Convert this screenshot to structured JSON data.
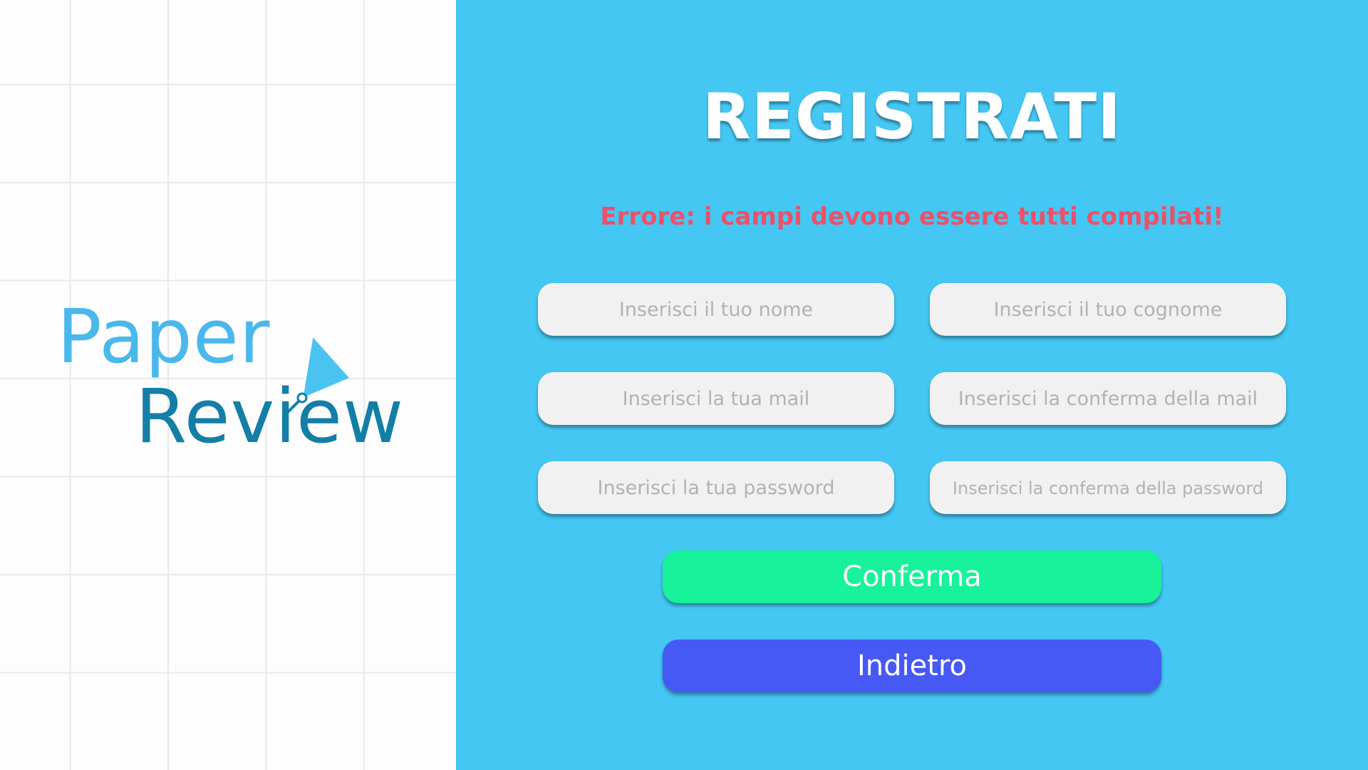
{
  "brand": {
    "line1": "Paper",
    "line2": "Review",
    "colors": {
      "paper": "#4ab8ea",
      "review": "#137ea6"
    }
  },
  "form": {
    "title": "REGISTRATI",
    "error": "Errore: i campi devono essere tutti compilati!",
    "fields": {
      "nome": {
        "placeholder": "Inserisci il tuo nome",
        "value": ""
      },
      "cognome": {
        "placeholder": "Inserisci il tuo cognome",
        "value": ""
      },
      "mail": {
        "placeholder": "Inserisci la tua mail",
        "value": ""
      },
      "conferma_mail": {
        "placeholder": "Inserisci la conferma della mail",
        "value": ""
      },
      "password": {
        "placeholder": "Inserisci la tua password",
        "value": ""
      },
      "conferma_password": {
        "placeholder": "Inserisci la conferma della password",
        "value": ""
      }
    },
    "buttons": {
      "confirm": "Conferma",
      "back": "Indietro"
    }
  },
  "colors": {
    "panel_background": "#44c7f3",
    "error": "#ec5169",
    "confirm_button": "#17f29b",
    "back_button": "#4659f5",
    "field_background": "#f1f1f1"
  }
}
